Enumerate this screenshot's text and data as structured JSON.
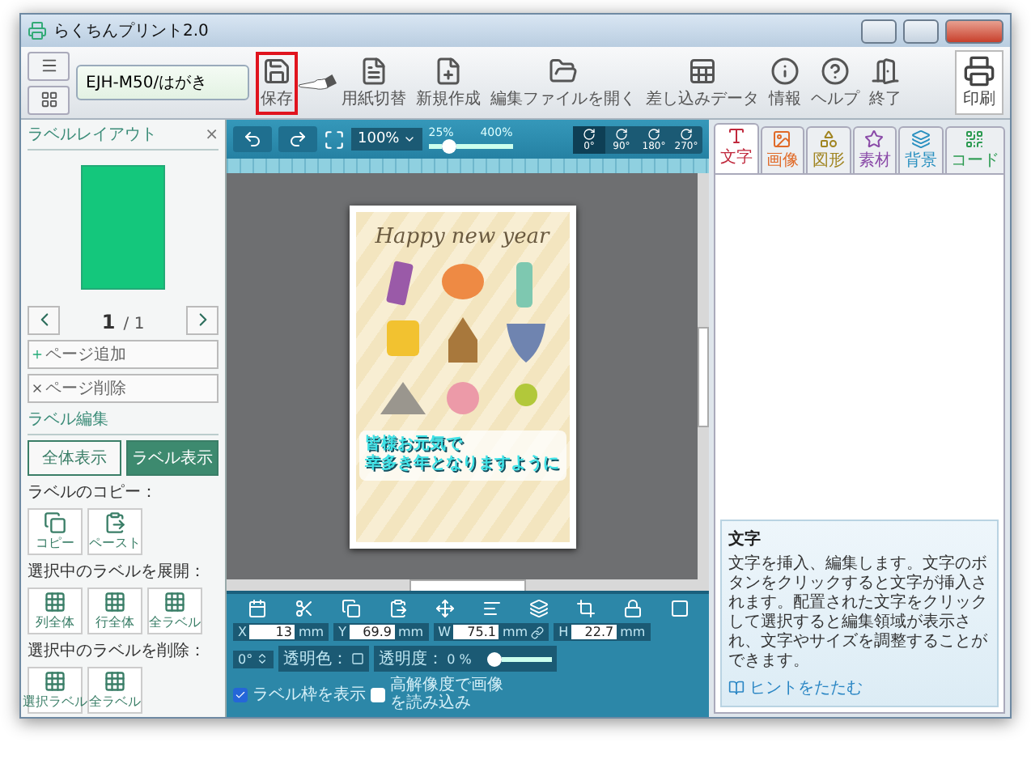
{
  "window": {
    "title": "らくちんプリント2.0"
  },
  "toolbar": {
    "printer_field": {
      "value": "EJH-M50/はがき"
    },
    "buttons": [
      {
        "label": "保存",
        "kind": "save",
        "highlighted": true
      },
      {
        "label": "用紙切替",
        "kind": "paper",
        "highlighted": false
      },
      {
        "label": "新規作成",
        "kind": "new",
        "highlighted": false
      },
      {
        "label": "編集ファイルを開く",
        "kind": "open",
        "highlighted": false
      },
      {
        "label": "差し込みデータ",
        "kind": "data",
        "highlighted": false
      },
      {
        "label": "情報",
        "kind": "info",
        "highlighted": false
      },
      {
        "label": "ヘルプ",
        "kind": "help",
        "highlighted": false
      },
      {
        "label": "終了",
        "kind": "exit",
        "highlighted": false
      }
    ],
    "print_button": {
      "label": "印刷"
    }
  },
  "left_panel": {
    "title": "ラベルレイアウト",
    "close": "×",
    "page_current": "1",
    "page_total": "/ 1",
    "page_buttons": [
      {
        "label": "ページ追加",
        "kind": "add"
      },
      {
        "label": "ページ削除",
        "kind": "delete"
      }
    ],
    "edit_title": "ラベル編集",
    "view_buttons": [
      {
        "label": "全体表示",
        "selected": false
      },
      {
        "label": "ラベル表示",
        "selected": true
      }
    ],
    "groups": [
      {
        "title": "ラベルのコピー：",
        "buttons": [
          {
            "label": "コピー",
            "kind": "copy"
          },
          {
            "label": "ペースト",
            "kind": "paste"
          }
        ]
      },
      {
        "title": "選択中のラベルを展開：",
        "buttons": [
          {
            "label": "列全体",
            "kind": "grid"
          },
          {
            "label": "行全体",
            "kind": "grid"
          },
          {
            "label": "全ラベル",
            "kind": "grid"
          }
        ]
      },
      {
        "title": "選択中のラベルを削除：",
        "buttons": [
          {
            "label": "選択ラベル",
            "kind": "grid"
          },
          {
            "label": "全ラベル",
            "kind": "grid"
          }
        ]
      }
    ]
  },
  "canvas_toolbar": {
    "zoom": "100%",
    "zoom_min": "25%",
    "zoom_max": "400%",
    "zoom_slider": {
      "level": 0.2
    },
    "rotations": [
      {
        "label": "0°",
        "selected": true
      },
      {
        "label": "90°",
        "selected": false
      },
      {
        "label": "180°",
        "selected": false
      },
      {
        "label": "270°",
        "selected": false
      }
    ]
  },
  "card": {
    "greeting": "Happy new year",
    "message_lines": [
      "皆様お元気で",
      "幸多き年となりますように"
    ]
  },
  "properties": {
    "fields": [
      {
        "label": "X",
        "value": "13",
        "unit": "mm"
      },
      {
        "label": "Y",
        "value": "69.9",
        "unit": "mm"
      },
      {
        "label": "W",
        "value": "75.1",
        "unit": "mm"
      },
      {
        "label": "H",
        "value": "22.7",
        "unit": "mm"
      }
    ],
    "rotation": "0°",
    "transparent_color": "透明色：",
    "show_frame": {
      "label": "ラベル枠を表示",
      "checked": true
    },
    "high_res": {
      "label": "高解像度で画像を読み込み",
      "checked": false
    },
    "opacity": {
      "label": "透明度：",
      "value": "0 %",
      "level": 0
    }
  },
  "right_panel": {
    "tabs": [
      {
        "label": "文字",
        "kind": "text",
        "selected": true
      },
      {
        "label": "画像",
        "kind": "image",
        "selected": false
      },
      {
        "label": "図形",
        "kind": "shape",
        "selected": false
      },
      {
        "label": "素材",
        "kind": "material",
        "selected": false
      },
      {
        "label": "背景",
        "kind": "background",
        "selected": false
      },
      {
        "label": "コード",
        "kind": "code",
        "selected": false
      }
    ],
    "hint": {
      "title": "文字",
      "body": "文字を挿入、編集します。文字のボタンをクリックすると文字が挿入されます。配置された文字をクリックして選択すると編集領域が表示され、文字やサイズを調整することができます。",
      "collapse": "ヒントをたたむ"
    }
  }
}
